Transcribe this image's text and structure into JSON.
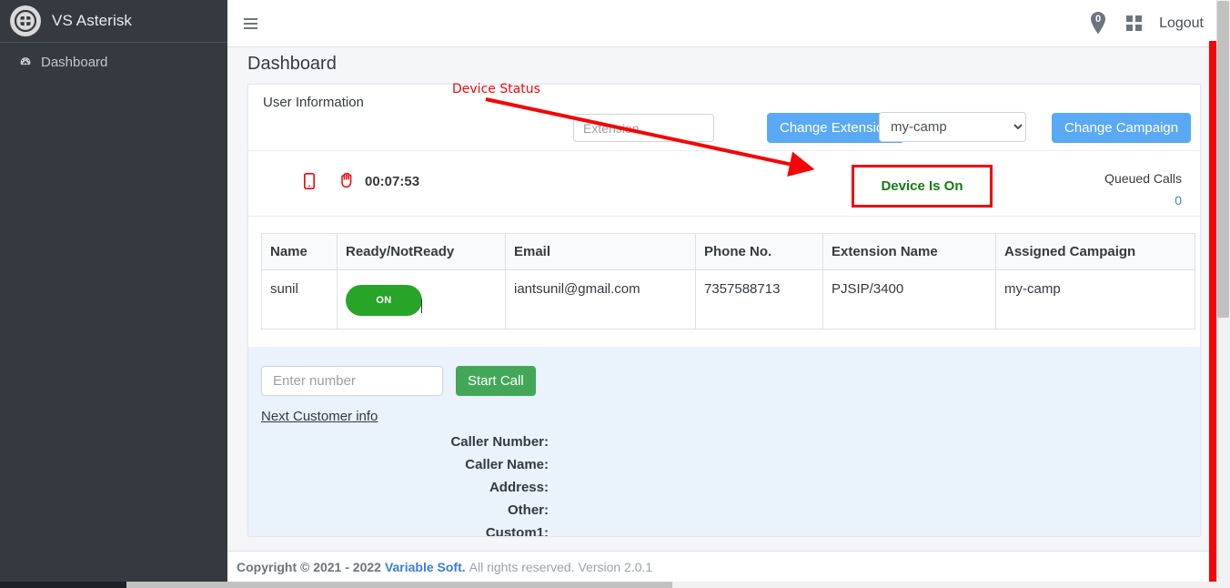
{
  "sidebar": {
    "brand_title": "VS Asterisk",
    "logo_icon": "asterisk-circle-logo",
    "items": [
      {
        "label": "Dashboard",
        "icon": "tachometer-dashboard-icon"
      }
    ]
  },
  "navbar": {
    "menu_icon": "hamburger-menu-icon",
    "pin_icon": "map-pin-badge-icon",
    "pin_count": "0",
    "grid_icon": "grid-squares-icon",
    "logout_label": "Logout"
  },
  "page": {
    "title": "Dashboard"
  },
  "card": {
    "title": "User Information",
    "extension_input_placeholder": "Extension",
    "extension_input_value": "",
    "change_extension_label": "Change Extension",
    "campaign_selected": "my-camp",
    "campaign_options": [
      "my-camp"
    ],
    "change_campaign_label": "Change Campaign"
  },
  "status": {
    "mobile_icon": "mobile-phone-icon",
    "hand_icon": "hand-stop-icon",
    "timer": "00:07:53",
    "device_status": "Device Is On",
    "queued_calls_label": "Queued Calls",
    "queued_calls_count": "0"
  },
  "table": {
    "headers": [
      "Name",
      "Ready/NotReady",
      "Email",
      "Phone No.",
      "Extension Name",
      "Assigned Campaign"
    ],
    "rows": [
      {
        "name": "sunil",
        "ready_state": "ON",
        "email": "iantsunil@gmail.com",
        "phone": "7357588713",
        "extension_name": "PJSIP/3400",
        "assigned_campaign": "my-camp"
      }
    ]
  },
  "dialer": {
    "number_placeholder": "Enter number",
    "number_value": "",
    "start_call_label": "Start Call",
    "next_customer_label": "Next Customer info",
    "fields": [
      {
        "label": "Caller Number:",
        "value": ""
      },
      {
        "label": "Caller Name:",
        "value": ""
      },
      {
        "label": "Address:",
        "value": ""
      },
      {
        "label": "Other:",
        "value": ""
      },
      {
        "label": "Custom1:",
        "value": ""
      }
    ]
  },
  "footer": {
    "copyright": "Copyright © 2021 - 2022",
    "brand": "Variable Soft.",
    "rest": "All rights reserved. Version 2.0.1"
  },
  "annotations": {
    "device_status_label": "Device Status",
    "arrow_color": "#f50505",
    "highlight_color": "#f50505"
  },
  "colors": {
    "sidebar_bg": "#343a40",
    "primary_blue": "#5aa9f5",
    "success_green": "#28a428",
    "call_green": "#42a858",
    "status_green": "#0f7c0f",
    "link_blue": "#3a7fd5",
    "panel_blue": "#eaf2fc"
  }
}
